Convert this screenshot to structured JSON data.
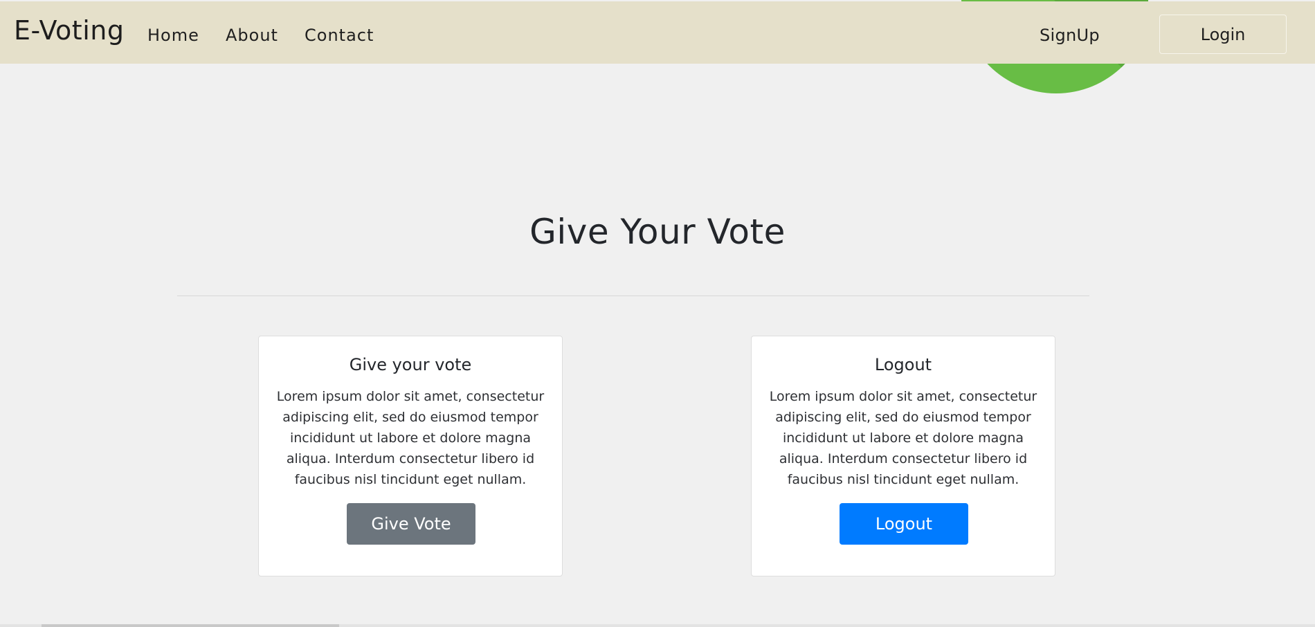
{
  "navbar": {
    "brand": "E-Voting",
    "links": {
      "home": "Home",
      "about": "About",
      "contact": "Contact"
    },
    "signup": "SignUp",
    "login": "Login"
  },
  "main": {
    "title": "Give Your Vote",
    "cards": {
      "vote": {
        "title": "Give your vote",
        "text": "Lorem ipsum dolor sit amet, consectetur adipiscing elit, sed do eiusmod tempor incididunt ut labore et dolore magna aliqua. Interdum consectetur libero id faucibus nisl tincidunt eget nullam.",
        "button": "Give Vote"
      },
      "logout": {
        "title": "Logout",
        "text": "Lorem ipsum dolor sit amet, consectetur adipiscing elit, sed do eiusmod tempor incididunt ut labore et dolore magna aliqua. Interdum consectetur libero id faucibus nisl tincidunt eget nullam.",
        "button": "Logout"
      }
    }
  },
  "colors": {
    "navbar_bg": "#e5e0ca",
    "page_bg": "#f0f0f0",
    "secondary_button": "#6c757d",
    "primary_button": "#007bff",
    "decor_green": "#68bd45"
  }
}
